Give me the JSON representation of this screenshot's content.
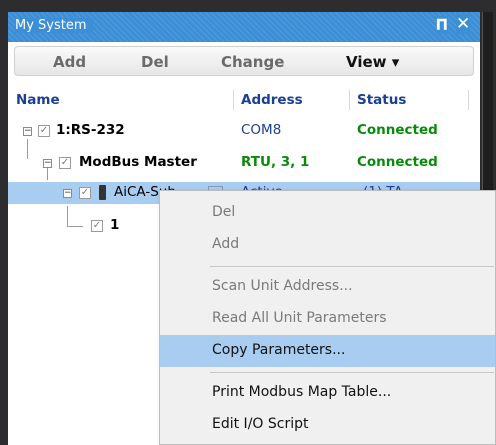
{
  "panel": {
    "title": "My System",
    "pin_icon": "pin-icon",
    "close_icon": "close-icon"
  },
  "toolbar": {
    "add": "Add",
    "del": "Del",
    "change": "Change",
    "view": "View ▾"
  },
  "columns": {
    "name": "Name",
    "address": "Address",
    "status": "Status"
  },
  "tree": [
    {
      "label": "1:RS-232",
      "address": "COM8",
      "status": "Connected"
    },
    {
      "label": "ModBus Master",
      "address": "RTU, 3, 1",
      "status": "Connected"
    },
    {
      "label": "AiCA-Sub",
      "address": "Active",
      "status": "(1) TA"
    },
    {
      "label": "1"
    }
  ],
  "context_menu": {
    "del": "Del",
    "add": "Add",
    "scan_unit_address": "Scan Unit Address...",
    "read_all_unit_parameters": "Read All Unit Parameters",
    "copy_parameters": "Copy Parameters...",
    "print_modbus_map_table": "Print Modbus Map Table...",
    "edit_io_script": "Edit I/O Script"
  },
  "colors": {
    "titlebar": "#3c8fd6",
    "selection": "#a8cdf0",
    "status_green": "#0a8a0a",
    "header_blue": "#1c3f94"
  }
}
